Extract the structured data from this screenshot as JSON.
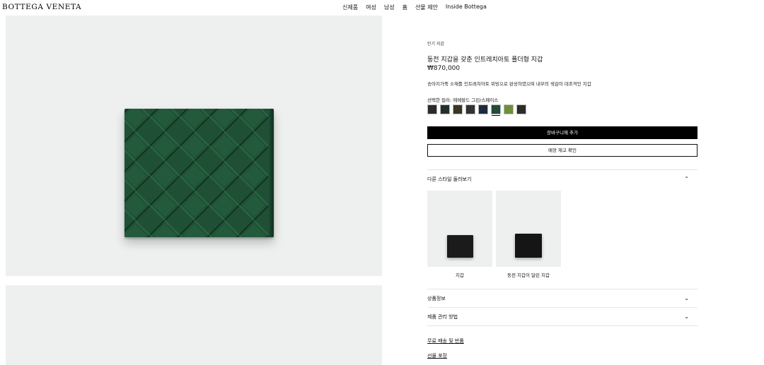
{
  "header": {
    "logo": "BOTTEGA VENETA",
    "nav": [
      "신제품",
      "여성",
      "남성",
      "홈",
      "선물 제안",
      "Inside Bottega"
    ]
  },
  "product": {
    "breadcrumb": "인기 지갑",
    "title": "동전 지갑을 갖춘 인트레치아토 폴더형 지갑",
    "price": "₩870,000",
    "description": "송아지가죽 소재를 인트레치아토 위빙으로 완성하였으며 내부의 색감이 대조적인 지갑",
    "selected_color_label": "선택한 컬러: 에메랄드 그린/스페이스",
    "swatches": [
      {
        "color": "#2b2b2b"
      },
      {
        "color": "#22302a"
      },
      {
        "color": "#3a3524"
      },
      {
        "color": "#33322f"
      },
      {
        "color": "#1f2a3c"
      },
      {
        "color": "#1f4d35",
        "selected": true
      },
      {
        "color": "#6f8f3a"
      },
      {
        "color": "#2a2b2a"
      }
    ],
    "image_color": "#1f5035"
  },
  "actions": {
    "add_to_cart": "장바구니에 추가",
    "check_stock": "매장 재고 확인"
  },
  "other_styles": {
    "heading": "다른 스타일 둘러보기",
    "items": [
      {
        "label": "지갑"
      },
      {
        "label": "동전 지갑이 달린 지갑"
      }
    ]
  },
  "accordions": {
    "details": "상품정보",
    "care": "제품 관리 방법"
  },
  "links": {
    "shipping": "무료 배송 및 반품",
    "gift": "선물 포장"
  }
}
